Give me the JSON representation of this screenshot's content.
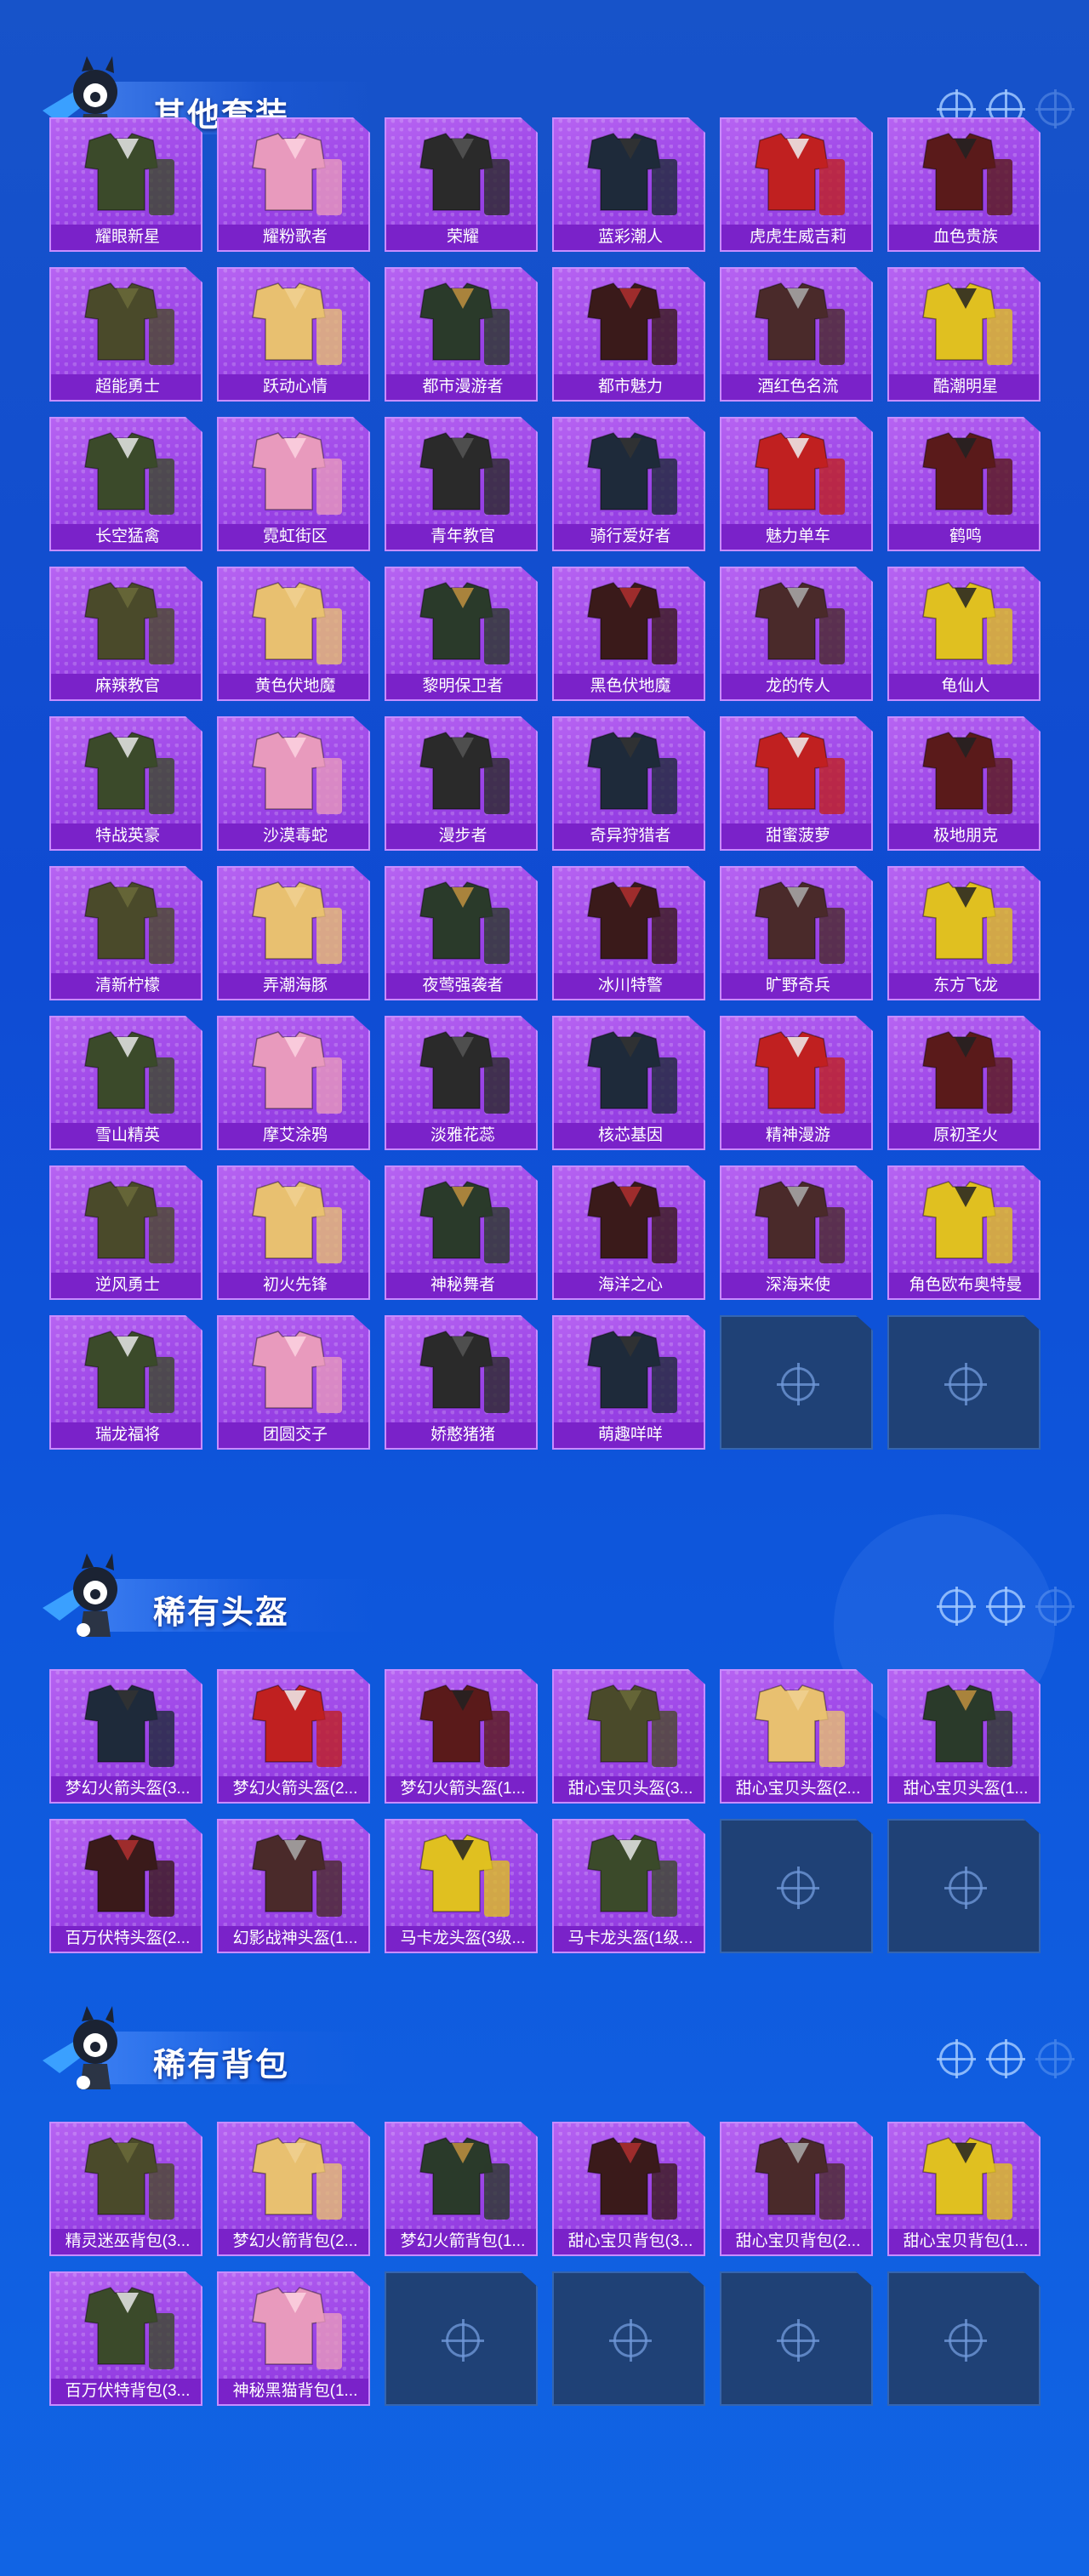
{
  "sections": [
    {
      "title": "其他套装",
      "items": [
        "耀眼新星",
        "耀粉歌者",
        "荣耀",
        "蓝彩潮人",
        "虎虎生威吉莉",
        "血色贵族",
        "超能勇士",
        "跃动心情",
        "都市漫游者",
        "都市魅力",
        "酒红色名流",
        "酷潮明星",
        "长空猛禽",
        "霓虹街区",
        "青年教官",
        "骑行爱好者",
        "魅力单车",
        "鹤鸣",
        "麻辣教官",
        "黄色伏地魔",
        "黎明保卫者",
        "黑色伏地魔",
        "龙的传人",
        "龟仙人",
        "特战英豪",
        "沙漠毒蛇",
        "漫步者",
        "奇异狩猎者",
        "甜蜜菠萝",
        "极地朋克",
        "清新柠檬",
        "弄潮海豚",
        "夜莺强袭者",
        "冰川特警",
        "旷野奇兵",
        "东方飞龙",
        "雪山精英",
        "摩艾涂鸦",
        "淡雅花蕊",
        "核芯基因",
        "精神漫游",
        "原初圣火",
        "逆风勇士",
        "初火先锋",
        "神秘舞者",
        "海洋之心",
        "深海来使",
        "角色欧布奥特曼",
        "瑞龙福将",
        "团圆交子",
        "娇憨猪猪",
        "萌趣咩咩",
        "",
        ""
      ]
    },
    {
      "title": "稀有头盔",
      "items": [
        "梦幻火箭头盔(3...",
        "梦幻火箭头盔(2...",
        "梦幻火箭头盔(1...",
        "甜心宝贝头盔(3...",
        "甜心宝贝头盔(2...",
        "甜心宝贝头盔(1...",
        "百万伏特头盔(2...",
        "幻影战神头盔(1...",
        "马卡龙头盔(3级...",
        "马卡龙头盔(1级...",
        "",
        ""
      ]
    },
    {
      "title": "稀有背包",
      "items": [
        "精灵迷巫背包(3...",
        "梦幻火箭背包(2...",
        "梦幻火箭背包(1...",
        "甜心宝贝背包(3...",
        "甜心宝贝背包(2...",
        "甜心宝贝背包(1...",
        "百万伏特背包(3...",
        "神秘黑猫背包(1...",
        "",
        "",
        "",
        ""
      ]
    }
  ],
  "colors": {
    "card_bg": "#9a43e6",
    "label_bg": "#7a22c9",
    "empty_bg": "#1f4176",
    "page_bg": "#1753c9"
  }
}
